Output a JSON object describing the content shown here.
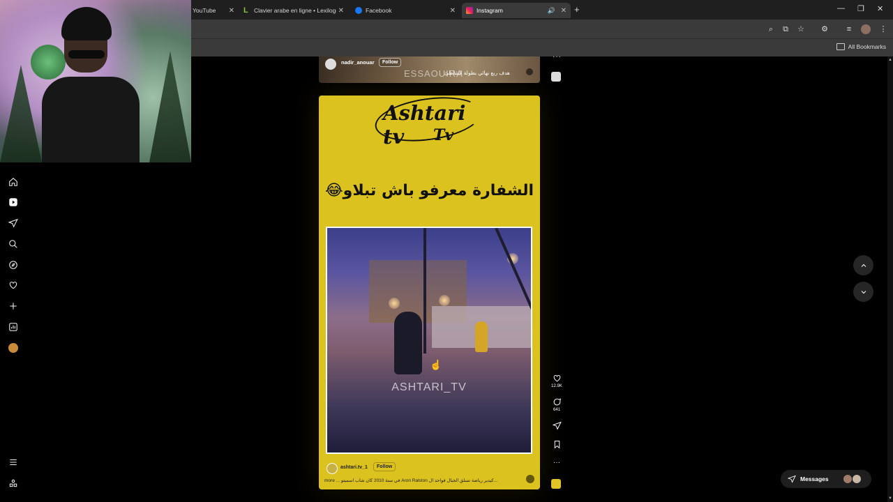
{
  "browser": {
    "tabs": [
      {
        "label": "YouTube",
        "icon": "youtube-icon"
      },
      {
        "label": "Clavier arabe en ligne • Lexilogos",
        "icon": "lexilogos-icon"
      },
      {
        "label": "Facebook",
        "icon": "facebook-icon"
      },
      {
        "label": "Instagram",
        "icon": "instagram-icon",
        "active": true
      }
    ],
    "bookmarks_label": "All Bookmarks"
  },
  "prev_reel": {
    "username": "nadir_anouar",
    "follow_label": "Follow",
    "watermark": "ESSAOUIRA",
    "caption": "هدف ربع نهائي بطولة الشاطئ"
  },
  "reel": {
    "logo_line1": "Ashtari tv",
    "logo_line2": "Tv",
    "headline": "الشفارة معرفو باش تبلاو😂",
    "video_watermark": "ASHTARI_TV",
    "username": "ashtari.tv_1",
    "follow_label": "Follow",
    "caption": "more ... ‏في سنة 2010 كان شاب اسميتو Aron Ralston كيدير رياضة تسلق الجبال فواحد ال...",
    "likes": "12.9K",
    "comments": "641",
    "accent_color": "#dcc21f"
  },
  "messages": {
    "label": "Messages"
  }
}
